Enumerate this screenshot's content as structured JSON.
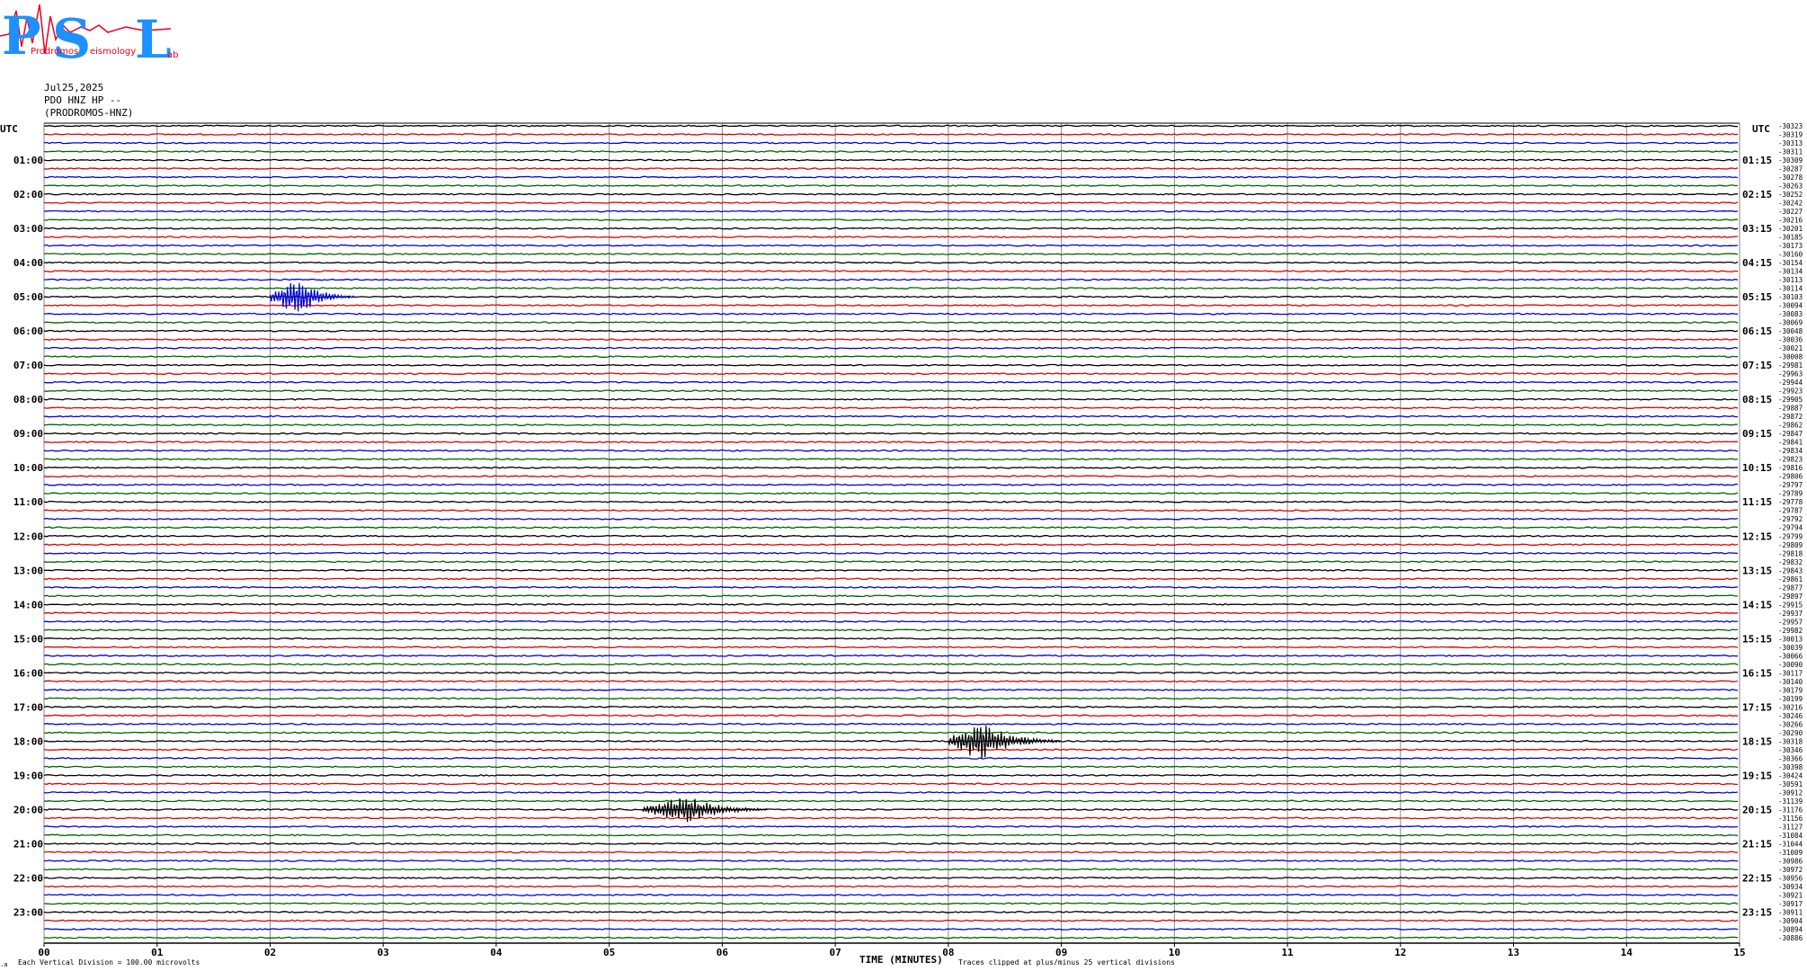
{
  "logo": {
    "letters": [
      "P",
      "S",
      "L"
    ],
    "subtitle_words": [
      "Prodromos",
      "eismology",
      "ab"
    ],
    "colors": {
      "letters": "#1e90ff",
      "trace": "#e8001c"
    }
  },
  "header": {
    "date": "Jul25,2025",
    "station": "PDO HNZ HP --",
    "site": "(PRODROMOS-HNZ)"
  },
  "axis": {
    "left_label": "UTC",
    "right_label": "UTC",
    "xlabel": "TIME (MINUTES)",
    "scale_note": "Each Vertical Division =  100.00 microvolts",
    "clip_note": "Traces clipped at plus/minus 25 vertical divisions",
    "corner_mark": ".a"
  },
  "chart_data": {
    "type": "line",
    "title": "",
    "xlim": [
      0,
      15
    ],
    "x_ticks": [
      "00",
      "01",
      "02",
      "03",
      "04",
      "05",
      "06",
      "07",
      "08",
      "09",
      "10",
      "11",
      "12",
      "13",
      "14",
      "15"
    ],
    "row_minutes": 15,
    "rows": 96,
    "trace_color_cycle": [
      "#000000",
      "#e00000",
      "#0000e0",
      "#006400"
    ],
    "left_hour_labels": [
      "01:00",
      "02:00",
      "03:00",
      "04:00",
      "05:00",
      "06:00",
      "07:00",
      "08:00",
      "09:00",
      "10:00",
      "11:00",
      "12:00",
      "13:00",
      "14:00",
      "15:00",
      "16:00",
      "17:00",
      "18:00",
      "19:00",
      "20:00",
      "21:00",
      "22:00",
      "23:00"
    ],
    "right_hour_labels": [
      "01:15",
      "02:15",
      "03:15",
      "04:15",
      "05:15",
      "06:15",
      "07:15",
      "08:15",
      "09:15",
      "10:15",
      "11:15",
      "12:15",
      "13:15",
      "14:15",
      "15:15",
      "16:15",
      "17:15",
      "18:15",
      "19:15",
      "20:15",
      "21:15",
      "22:15",
      "23:15"
    ],
    "offsets": [
      "-30323",
      "-30319",
      "-30313",
      "-30311",
      "-30309",
      "-30287",
      "-30278",
      "-30263",
      "-30252",
      "-30242",
      "-30227",
      "-30216",
      "-30201",
      "-30185",
      "-30173",
      "-30160",
      "-30154",
      "-30134",
      "-30113",
      "-30114",
      "-30103",
      "-30094",
      "-30083",
      "-30069",
      "-30048",
      "-30036",
      "-30021",
      "-30008",
      "-29981",
      "-29963",
      "-29944",
      "-29923",
      "-29905",
      "-29887",
      "-29872",
      "-29862",
      "-29847",
      "-29841",
      "-29834",
      "-29823",
      "-29816",
      "-29806",
      "-29797",
      "-29789",
      "-29778",
      "-29787",
      "-29792",
      "-29794",
      "-29799",
      "-29809",
      "-29818",
      "-29832",
      "-29843",
      "-29861",
      "-29877",
      "-29897",
      "-29915",
      "-29937",
      "-29957",
      "-29982",
      "-30013",
      "-30039",
      "-30066",
      "-30090",
      "-30117",
      "-30140",
      "-30179",
      "-30199",
      "-30216",
      "-30246",
      "-30266",
      "-30290",
      "-30318",
      "-30346",
      "-30366",
      "-30398",
      "-30424",
      "-30591",
      "-30912",
      "-31139",
      "-31176",
      "-31156",
      "-31127",
      "-31084",
      "-31044",
      "-31009",
      "-30986",
      "-30972",
      "-30956",
      "-30934",
      "-30921",
      "-30917",
      "-30911",
      "-30904",
      "-30894",
      "-30886"
    ],
    "events": [
      {
        "hour": 5,
        "minute_start": 2.0,
        "minute_peak": 2.25,
        "minute_end": 2.75,
        "peak_divisions": 4,
        "color_index": 2
      },
      {
        "hour": 18,
        "minute_start": 8.0,
        "minute_peak": 8.3,
        "minute_end": 9.0,
        "peak_divisions": 4,
        "color_index": 0
      },
      {
        "hour": 20,
        "minute_start": 5.3,
        "minute_peak": 5.7,
        "minute_end": 6.4,
        "peak_divisions": 3,
        "color_index": 0
      }
    ]
  }
}
